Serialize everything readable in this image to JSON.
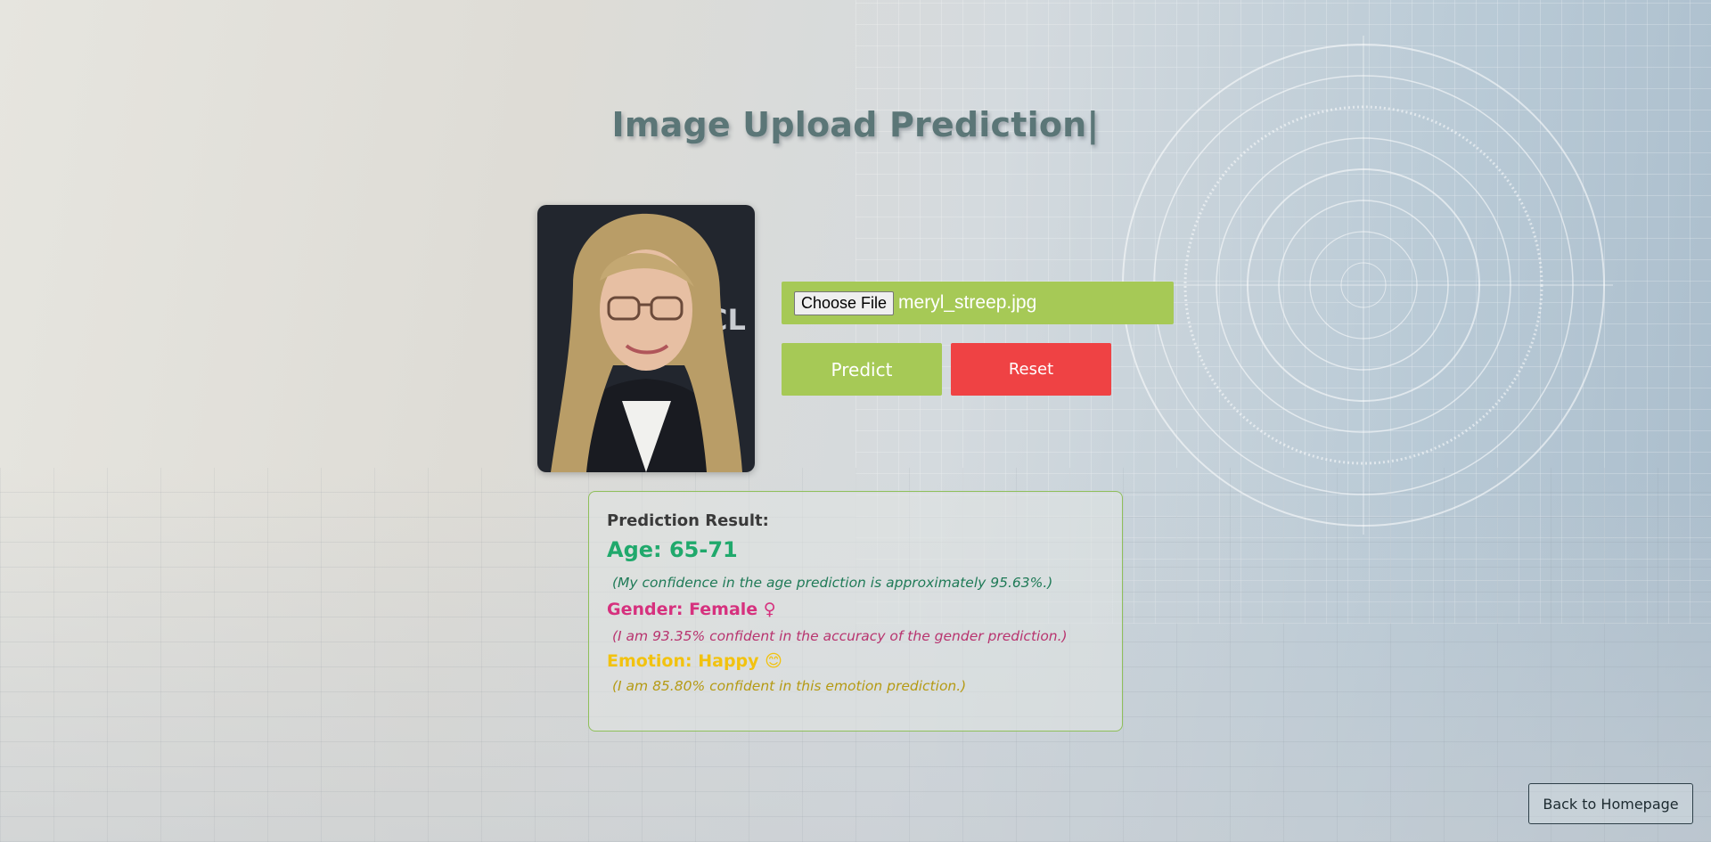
{
  "page": {
    "title": "Image Upload Prediction|"
  },
  "upload": {
    "choose_file_label": "Choose File",
    "file_name": "meryl_streep.jpg"
  },
  "actions": {
    "predict_label": "Predict",
    "reset_label": "Reset"
  },
  "result": {
    "heading": "Prediction Result:",
    "age": "Age: 65-71",
    "age_note": "(My confidence in the age prediction is approximately 95.63%.)",
    "gender": "Gender: Female ♀",
    "gender_note": "(I am 93.35% confident in the accuracy of the gender prediction.)",
    "emotion": "Emotion: Happy 😊",
    "emotion_note": "(I am 85.80% confident in this emotion prediction.)"
  },
  "footer": {
    "back_label": "Back to Homepage"
  },
  "colors": {
    "accent_green": "#a6c956",
    "reset_red": "#ef4244",
    "age_color": "#20a96c",
    "gender_color": "#d6317e",
    "emotion_color": "#f2c20f"
  }
}
